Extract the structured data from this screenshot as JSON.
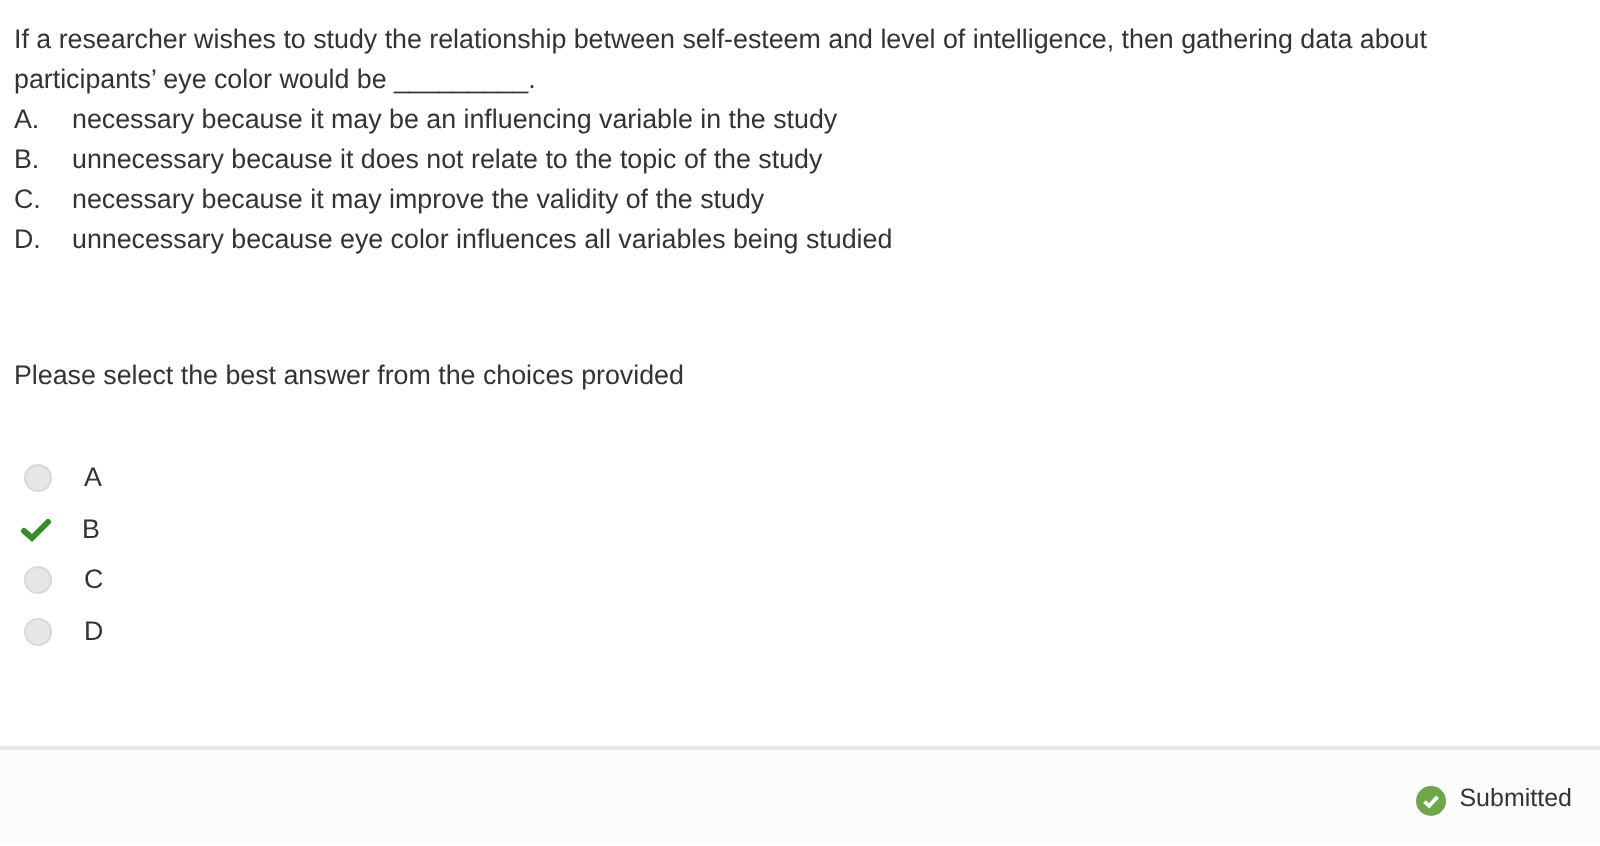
{
  "question": {
    "text": "If a researcher wishes to study the relationship between self-esteem and level of intelligence, then gathering data about participants’ eye color would be _________.",
    "choices": [
      {
        "letter": "A.",
        "text": "necessary because it may be an influencing variable in the study"
      },
      {
        "letter": "B.",
        "text": "unnecessary because it does not relate to the topic of the study"
      },
      {
        "letter": "C.",
        "text": "necessary because it may improve the validity of the study"
      },
      {
        "letter": "D.",
        "text": "unnecessary because eye color influences all variables being studied"
      }
    ]
  },
  "instruction": "Please select the best answer from the choices provided",
  "options": [
    {
      "label": "A",
      "selected": false
    },
    {
      "label": "B",
      "selected": true
    },
    {
      "label": "C",
      "selected": false
    },
    {
      "label": "D",
      "selected": false
    }
  ],
  "status": {
    "label": "Submitted"
  }
}
